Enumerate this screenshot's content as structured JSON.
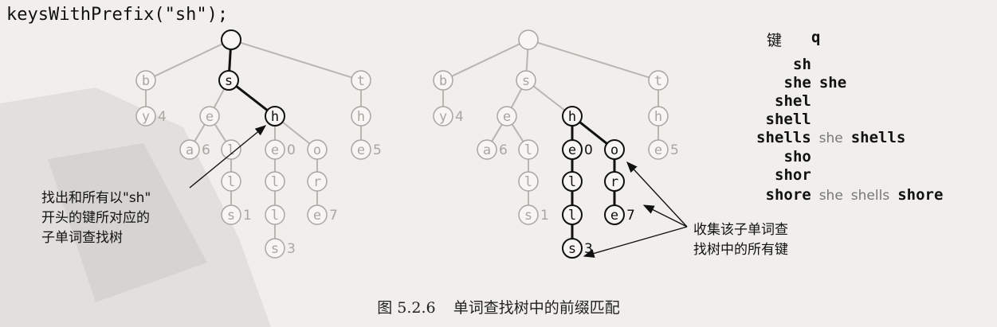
{
  "title": "keysWithPrefix(\"sh\");",
  "caption": {
    "figure": "图 5.2.6",
    "text": "单词查找树中的前缀匹配"
  },
  "annotations": {
    "left": [
      "找出和所有以\"sh\"",
      "开头的键所对应的",
      "子单词查找树"
    ],
    "right": [
      "收集该子单词查",
      "找树中的所有键"
    ]
  },
  "table": {
    "header_key": "键",
    "header_q": "q",
    "rows": [
      {
        "key": "sh",
        "q": []
      },
      {
        "key": "she",
        "q": [
          "she"
        ]
      },
      {
        "key": "shel",
        "q": []
      },
      {
        "key": "shell",
        "q": []
      },
      {
        "key": "shells",
        "q": [
          "she",
          "shells"
        ]
      },
      {
        "key": "sho",
        "q": []
      },
      {
        "key": "shor",
        "q": []
      },
      {
        "key": "shore",
        "q": [
          "she",
          "shells",
          "shore"
        ]
      }
    ]
  },
  "trie": {
    "nodes": [
      {
        "id": "root",
        "label": ""
      },
      {
        "id": "b",
        "label": "b"
      },
      {
        "id": "s",
        "label": "s"
      },
      {
        "id": "t",
        "label": "t"
      },
      {
        "id": "y",
        "label": "y",
        "value": "4"
      },
      {
        "id": "e1",
        "label": "e"
      },
      {
        "id": "h1",
        "label": "h"
      },
      {
        "id": "h2",
        "label": "h"
      },
      {
        "id": "a",
        "label": "a",
        "value": "6"
      },
      {
        "id": "l1",
        "label": "l"
      },
      {
        "id": "e2",
        "label": "e",
        "value": "0"
      },
      {
        "id": "o",
        "label": "o"
      },
      {
        "id": "e3",
        "label": "e",
        "value": "5"
      },
      {
        "id": "l2",
        "label": "l"
      },
      {
        "id": "l3",
        "label": "l"
      },
      {
        "id": "r",
        "label": "r"
      },
      {
        "id": "s1",
        "label": "s",
        "value": "1"
      },
      {
        "id": "l4",
        "label": "l"
      },
      {
        "id": "e4",
        "label": "e",
        "value": "7"
      },
      {
        "id": "s2",
        "label": "s",
        "value": "3"
      }
    ],
    "edges": [
      [
        "root",
        "b"
      ],
      [
        "root",
        "s"
      ],
      [
        "root",
        "t"
      ],
      [
        "b",
        "y"
      ],
      [
        "s",
        "e1"
      ],
      [
        "s",
        "h1"
      ],
      [
        "t",
        "h2"
      ],
      [
        "e1",
        "a"
      ],
      [
        "e1",
        "l1"
      ],
      [
        "h1",
        "e2"
      ],
      [
        "h1",
        "o"
      ],
      [
        "h2",
        "e3"
      ],
      [
        "l1",
        "l2"
      ],
      [
        "e2",
        "l3"
      ],
      [
        "o",
        "r"
      ],
      [
        "l2",
        "s1"
      ],
      [
        "l3",
        "l4"
      ],
      [
        "r",
        "e4"
      ],
      [
        "l4",
        "s2"
      ]
    ],
    "left_highlight_nodes": [
      "root",
      "s",
      "h1"
    ],
    "left_bold_edges": [
      [
        "root",
        "s"
      ],
      [
        "s",
        "h1"
      ]
    ],
    "right_highlight_nodes": [
      "h1",
      "e2",
      "o",
      "l3",
      "r",
      "l4",
      "e4",
      "s2"
    ]
  }
}
